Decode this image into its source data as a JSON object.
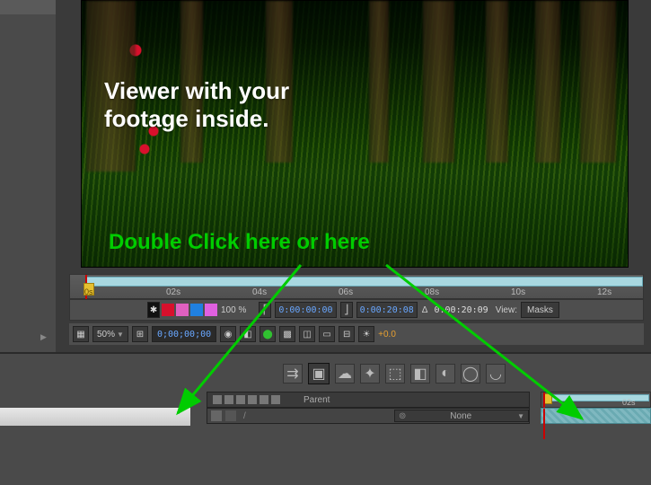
{
  "viewer": {
    "caption_line1": "Viewer with your",
    "caption_line2": "footage inside.",
    "annotation": "Double Click here or here"
  },
  "time_ruler_upper": {
    "playhead_label": "0s",
    "ticks": [
      "02s",
      "04s",
      "06s",
      "08s",
      "10s",
      "12s"
    ]
  },
  "controls": {
    "resolution_pct": "100 %",
    "tc_in": "0:00:00:00",
    "tc_out": "0:00:20:08",
    "tc_dur_prefix": "Δ",
    "tc_dur": "0:00:20:09",
    "view_label": "View:",
    "view_mode": "Masks"
  },
  "footer": {
    "zoom": "50%",
    "timecode": "0;00;00;00",
    "exposure": "+0.0"
  },
  "timeline": {
    "header": {
      "parent_label": "Parent"
    },
    "row": {
      "parent_value": "None"
    },
    "mini_ruler_ticks": [
      "02s"
    ]
  },
  "icons": {
    "man": "silhouette-icon",
    "swatch_red": "#d8102c",
    "swatch_magenta": "#e060c0",
    "swatch_blue": "#2080e0",
    "swatch_pink": "#e060e0"
  }
}
